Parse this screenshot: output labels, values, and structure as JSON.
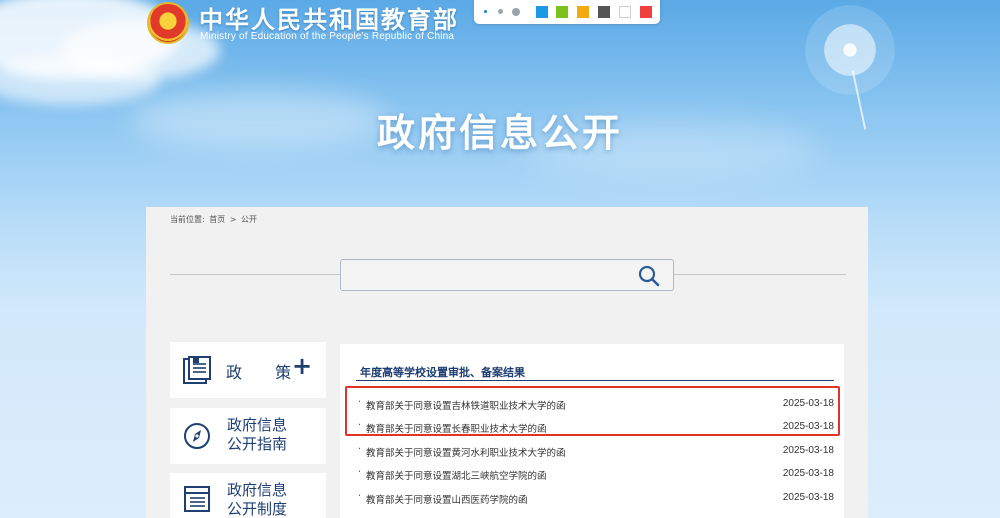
{
  "header": {
    "site_name_cn": "中华人民共和国教育部",
    "site_name_en": "Ministry of Education of the People's Republic of China",
    "theme_colors": [
      "#1a9ae5",
      "#7cc21c",
      "#f5a910",
      "#555555",
      "#ffffff",
      "#ef4040"
    ]
  },
  "banner": {
    "title": "政府信息公开"
  },
  "breadcrumb": {
    "label": "当前位置:",
    "home": "首页",
    "separator": ">",
    "current": "公开"
  },
  "search": {
    "value": "",
    "placeholder": ""
  },
  "sidebar": {
    "items": [
      {
        "label": "政 策",
        "plus": "+"
      },
      {
        "label": "政府信息公开指南"
      },
      {
        "label": "政府信息公开制度"
      }
    ]
  },
  "list": {
    "title": "年度高等学校设置审批、备案结果",
    "items": [
      {
        "text": "教育部关于同意设置吉林铁道职业技术大学的函",
        "date": "2025-03-18"
      },
      {
        "text": "教育部关于同意设置长春职业技术大学的函",
        "date": "2025-03-18"
      },
      {
        "text": "教育部关于同意设置黄河水利职业技术大学的函",
        "date": "2025-03-18"
      },
      {
        "text": "教育部关于同意设置湖北三峡航空学院的函",
        "date": "2025-03-18"
      },
      {
        "text": "教育部关于同意设置山西医药学院的函",
        "date": "2025-03-18"
      }
    ]
  }
}
